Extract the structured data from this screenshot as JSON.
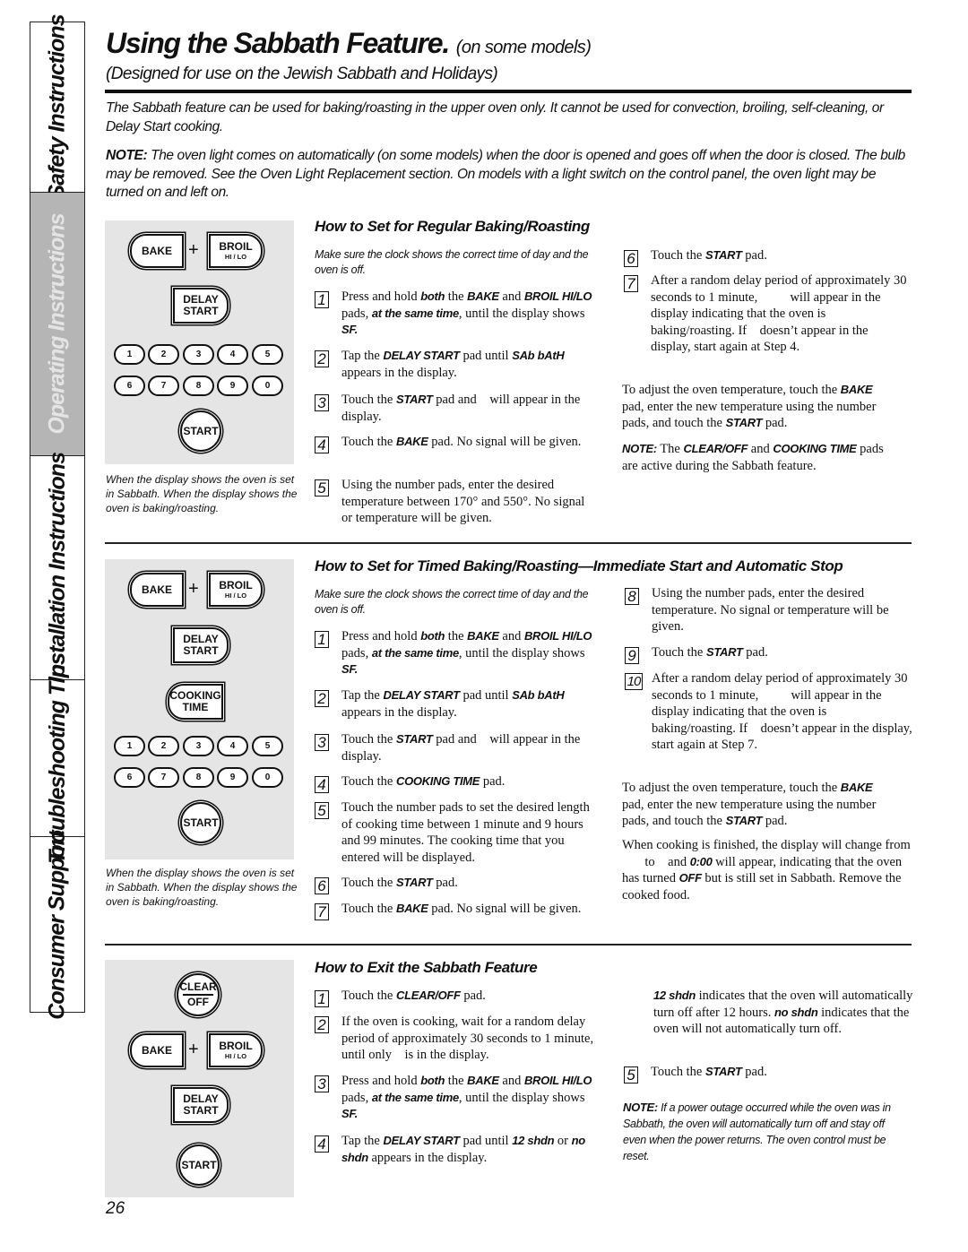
{
  "side_tabs": [
    {
      "label": "Safety Instructions",
      "active": false
    },
    {
      "label": "Operating Instructions",
      "active": true
    },
    {
      "label": "Installation Instructions",
      "active": false
    },
    {
      "label": "Troubleshooting Tips",
      "active": false
    },
    {
      "label": "Consumer Support",
      "active": false
    }
  ],
  "header": {
    "title": "Using the Sabbath Feature.",
    "title_suffix": "(on some models)",
    "subtitle": "(Designed for use on the Jewish Sabbath and Holidays)"
  },
  "intro": {
    "paragraph": "The Sabbath feature can be used for baking/roasting in the upper oven only. It cannot be used for convection, broiling, self-cleaning, or Delay Start cooking.",
    "note_label": "NOTE:",
    "note_text": " The oven light comes on automatically (on some models) when the door is opened and goes off when the door is closed. The bulb may be removed. See the Oven Light Replacement section. On models with a light switch on the control panel, the oven light may be turned on and left on."
  },
  "pads": {
    "bake": "BAKE",
    "plus": "+",
    "broil": "BROIL",
    "broil_sub": "HI / LO",
    "delay_1": "DELAY",
    "delay_2": "START",
    "cooking_1": "COOKING",
    "cooking_2": "TIME",
    "start": "START",
    "clear": "CLEAR",
    "off": "OFF",
    "numbers_row1": [
      "1",
      "2",
      "3",
      "4",
      "5"
    ],
    "numbers_row2": [
      "6",
      "7",
      "8",
      "9",
      "0"
    ]
  },
  "panel_caption": "When the display shows    the oven is set in Sabbath. When the display shows        the oven is baking/roasting.",
  "section_regular": {
    "heading": "How to Set for Regular Baking/Roasting",
    "prereq": "Make sure the clock shows the correct time of day and the oven is off.",
    "steps": [
      {
        "n": "1",
        "html": "Press and hold <span class='b'>both</span> the <span class='b'>BAKE</span> and <span class='b'>BROIL HI/LO</span> pads, <span class='b'>at the same time</span>, until the display shows <span class='b'>SF.</span>"
      },
      {
        "n": "2",
        "html": "Tap the <span class='b'>DELAY START</span> pad until <span class='b'>SAb bAtH</span> appears in the display."
      },
      {
        "n": "3",
        "html": "Touch the <span class='b'>START</span> pad and &nbsp;&nbsp;&nbsp;will appear in the display."
      },
      {
        "n": "4",
        "html": "Touch the <span class='b'>BAKE</span> pad. No signal will be given."
      },
      {
        "n": "5",
        "html": "Using the number pads, enter the desired temperature between 170° and 550°. No signal or temperature will be given."
      },
      {
        "n": "6",
        "html": "Touch the <span class='b'>START</span> pad."
      },
      {
        "n": "7",
        "html": "After a random delay period of approximately 30 seconds to 1 minute, &nbsp;&nbsp;&nbsp;&nbsp;&nbsp;&nbsp;&nbsp;&nbsp;&nbsp;will appear in the display indicating that the oven is baking/roasting. If &nbsp;&nbsp;&nbsp;doesn’t appear in the display, start again at Step 4."
      }
    ],
    "adjust_html": "To adjust the oven temperature, touch the <span class='b'>BAKE</span> pad, enter the new temperature using the number pads, and touch the <span class='b'>START</span> pad.",
    "note_html": "<span class='b'>NOTE:</span> The <span class='b'>CLEAR/OFF</span> and <span class='b'>COOKING TIME</span> pads are active during the Sabbath feature."
  },
  "section_timed": {
    "heading": "How to Set for Timed Baking/Roasting—Immediate Start and Automatic Stop",
    "prereq": "Make sure the clock shows the correct time of day and the oven is off.",
    "steps": [
      {
        "n": "1",
        "html": "Press and hold <span class='b'>both</span> the <span class='b'>BAKE</span> and <span class='b'>BROIL HI/LO</span> pads, <span class='b'>at the same time</span>, until the display shows <span class='b'>SF.</span>"
      },
      {
        "n": "2",
        "html": "Tap the <span class='b'>DELAY START</span> pad until <span class='b'>SAb bAtH</span> appears in the display."
      },
      {
        "n": "3",
        "html": "Touch the <span class='b'>START</span> pad and &nbsp;&nbsp;&nbsp;will appear in the display."
      },
      {
        "n": "4",
        "html": "Touch the <span class='b'>COOKING TIME</span> pad."
      },
      {
        "n": "5",
        "html": "Touch the number pads to set the desired length of cooking time between 1 minute and 9 hours and 99 minutes. The cooking time that you entered will be displayed."
      },
      {
        "n": "6",
        "html": "Touch the <span class='b'>START</span> pad."
      },
      {
        "n": "7",
        "html": "Touch the <span class='b'>BAKE</span> pad. No signal will be given."
      },
      {
        "n": "8",
        "html": "Using the number pads, enter the desired temperature. No signal or temperature will be given."
      },
      {
        "n": "9",
        "html": "Touch the <span class='b'>START</span> pad."
      },
      {
        "n": "10",
        "html": "After a random delay period of approximately 30 seconds to 1 minute, &nbsp;&nbsp;&nbsp;&nbsp;&nbsp;&nbsp;&nbsp;&nbsp;&nbsp;will appear in the display indicating that the oven is baking/roasting. If &nbsp;&nbsp;&nbsp;doesn’t appear in the display, start again at Step 7."
      }
    ],
    "adjust_html": "To adjust the oven temperature, touch the <span class='b'>BAKE</span> pad, enter the new temperature using the number pads, and touch the <span class='b'>START</span> pad.",
    "finished_html": "When cooking is finished, the display will change from &nbsp;&nbsp;&nbsp;&nbsp;&nbsp;&nbsp;&nbsp;to &nbsp;&nbsp;&nbsp;and <span class='b'>0:00</span> will appear, indicating that the oven has turned <span class='b'>OFF</span> but is still set in Sabbath. Remove the cooked food."
  },
  "section_exit": {
    "heading": "How to Exit the Sabbath Feature",
    "steps": [
      {
        "n": "1",
        "html": "Touch the <span class='b'>CLEAR/OFF</span> pad."
      },
      {
        "n": "2",
        "html": "If the oven is cooking, wait for a random delay period of approximately 30 seconds to 1 minute, until only &nbsp;&nbsp;&nbsp;is in the display."
      },
      {
        "n": "3",
        "html": "Press and hold <span class='b'>both</span> the <span class='b'>BAKE</span> and <span class='b'>BROIL HI/LO</span> pads, <span class='b'>at the same time</span>, until the display shows <span class='b'>SF.</span>"
      },
      {
        "n": "4",
        "html": "Tap the <span class='b'>DELAY START</span> pad until <span class='b'>12 shdn</span> or <span class='b'>no shdn</span> appears in the display."
      },
      {
        "n": "5",
        "html": "Touch the <span class='b'>START</span> pad."
      }
    ],
    "shdn_html": "<span class='b'>12 shdn</span> indicates that the oven will automatically turn off after 12 hours. <span class='b'>no shdn</span> indicates that the oven will not automatically turn off.",
    "note_label": "NOTE:",
    "note_text": " If a power outage occurred while the oven was in Sabbath, the oven will automatically turn off and stay off even when the power returns. The oven control must be reset."
  },
  "page_number": "26"
}
